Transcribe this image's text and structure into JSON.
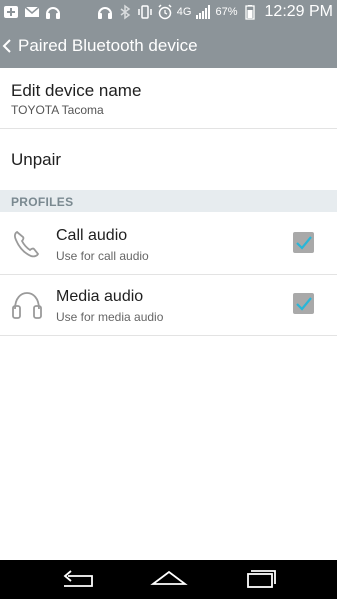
{
  "status_bar": {
    "battery_percent": "67%",
    "network_label": "4G",
    "time": "12:29 PM",
    "left_icons": [
      "add-icon",
      "mail-icon",
      "headphones-icon"
    ],
    "right_icons": [
      "headset-icon",
      "bluetooth-icon",
      "vibrate-icon",
      "alarm-icon",
      "signal-icon",
      "battery-icon"
    ]
  },
  "action_bar": {
    "title": "Paired Bluetooth device"
  },
  "edit_name": {
    "label": "Edit device name",
    "value": "TOYOTA Tacoma"
  },
  "unpair": {
    "label": "Unpair"
  },
  "profiles": {
    "header": "PROFILES",
    "items": [
      {
        "label": "Call audio",
        "summary": "Use for call audio",
        "checked": true,
        "icon": "phone-icon"
      },
      {
        "label": "Media audio",
        "summary": "Use for media audio",
        "checked": true,
        "icon": "headphones-icon"
      }
    ]
  },
  "colors": {
    "bar": "#8c9499",
    "check": "#29b6d8",
    "section_bg": "#e7ecef"
  }
}
